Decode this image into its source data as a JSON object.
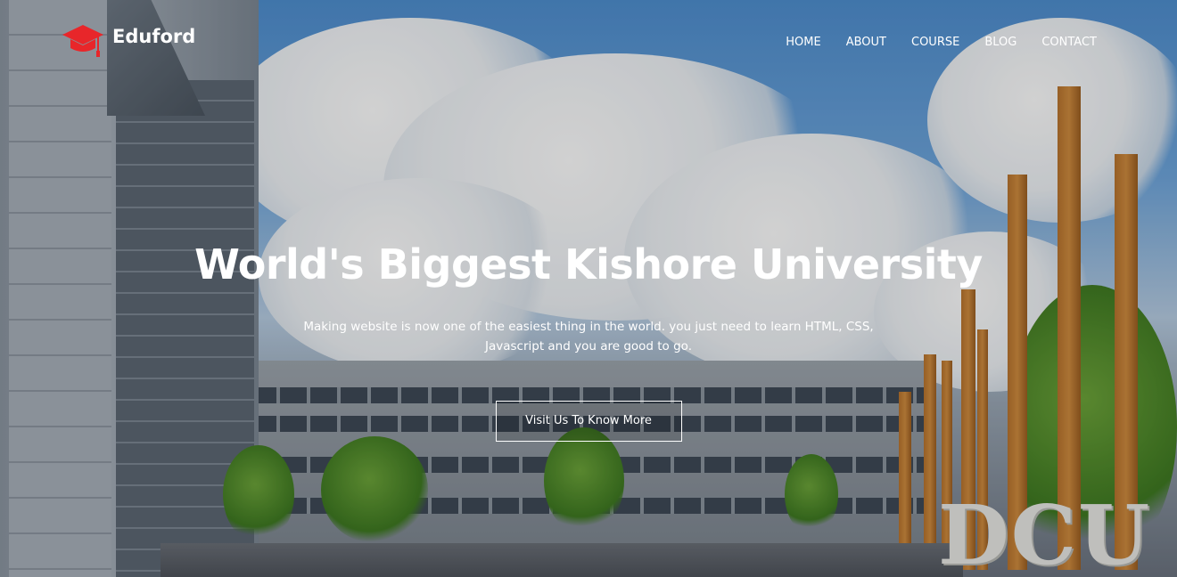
{
  "brand": {
    "name": "Eduford",
    "icon": "graduation-cap-icon",
    "icon_color": "#e8262a"
  },
  "nav": {
    "items": [
      {
        "label": "HOME"
      },
      {
        "label": "ABOUT"
      },
      {
        "label": "COURSE"
      },
      {
        "label": "BLOG"
      },
      {
        "label": "CONTACT"
      }
    ]
  },
  "hero": {
    "title": "World's Biggest Kishore University",
    "subtitle": "Making website is now one of the easiest thing in the world. you just need to learn HTML, CSS, Javascript and you are good to go.",
    "button_label": "Visit Us To Know More",
    "sign_text": "DCU"
  },
  "colors": {
    "text": "#ffffff",
    "accent": "#e8262a"
  }
}
